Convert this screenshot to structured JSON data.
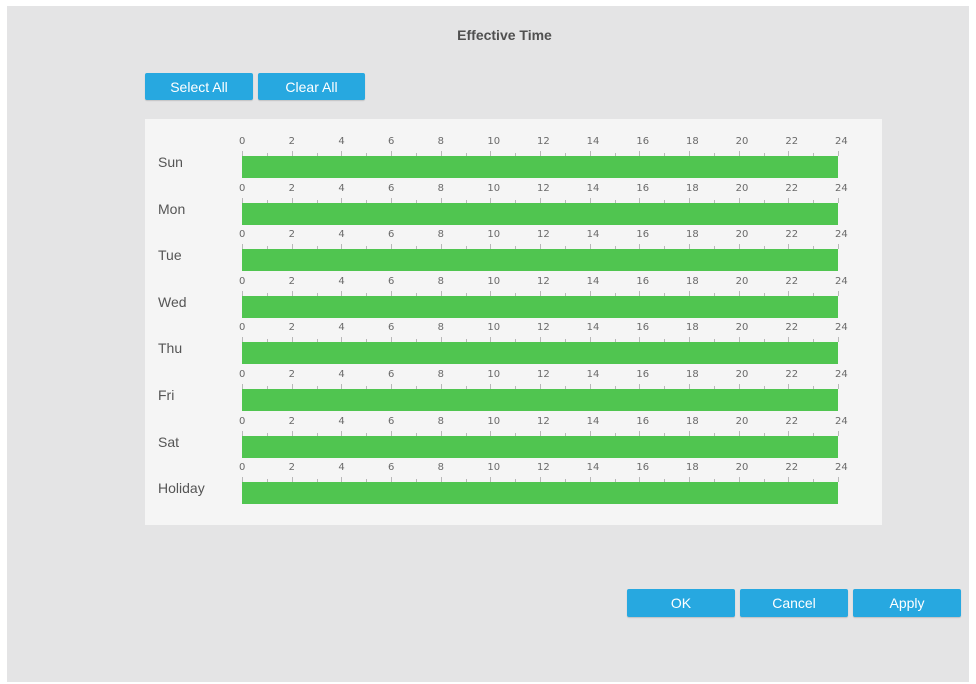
{
  "dialog": {
    "title": "Effective Time",
    "select_all_label": "Select All",
    "clear_all_label": "Clear All",
    "ok_label": "OK",
    "cancel_label": "Cancel",
    "apply_label": "Apply"
  },
  "schedule": {
    "hour_labels": [
      "0",
      "2",
      "4",
      "6",
      "8",
      "10",
      "12",
      "14",
      "16",
      "18",
      "20",
      "22",
      "24"
    ],
    "rows": [
      {
        "day": "Sun",
        "from_hour": 0,
        "to_hour": 24
      },
      {
        "day": "Mon",
        "from_hour": 0,
        "to_hour": 24
      },
      {
        "day": "Tue",
        "from_hour": 0,
        "to_hour": 24
      },
      {
        "day": "Wed",
        "from_hour": 0,
        "to_hour": 24
      },
      {
        "day": "Thu",
        "from_hour": 0,
        "to_hour": 24
      },
      {
        "day": "Fri",
        "from_hour": 0,
        "to_hour": 24
      },
      {
        "day": "Sat",
        "from_hour": 0,
        "to_hour": 24
      },
      {
        "day": "Holiday",
        "from_hour": 0,
        "to_hour": 24
      }
    ]
  },
  "colors": {
    "accent": "#27a8e0",
    "active_time": "#50c550",
    "background": "#e4e4e5",
    "panel": "#f5f5f5"
  }
}
